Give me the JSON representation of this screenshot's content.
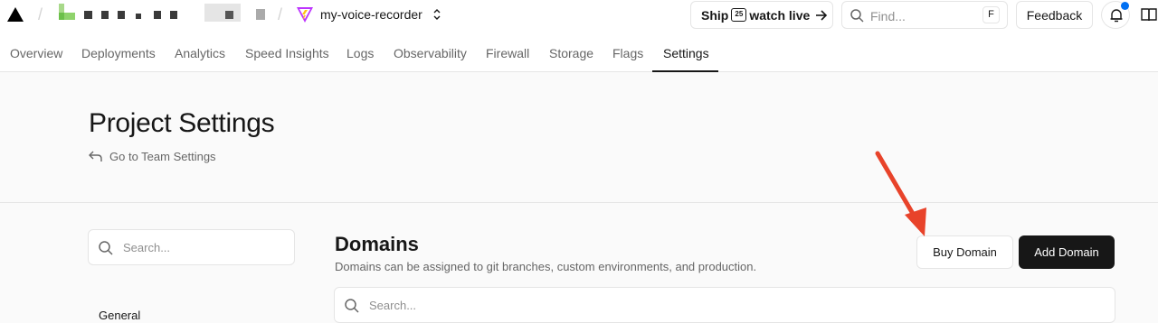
{
  "topbar": {
    "project_name": "my-voice-recorder",
    "ship_label_pre": "Ship",
    "ship_calendar_day": "25",
    "ship_label_post": "watch live",
    "find_placeholder": "Find...",
    "find_shortcut": "F",
    "feedback_label": "Feedback"
  },
  "tabs": [
    {
      "label": "Overview"
    },
    {
      "label": "Deployments"
    },
    {
      "label": "Analytics"
    },
    {
      "label": "Speed Insights"
    },
    {
      "label": "Logs"
    },
    {
      "label": "Observability"
    },
    {
      "label": "Firewall"
    },
    {
      "label": "Storage"
    },
    {
      "label": "Flags"
    },
    {
      "label": "Settings",
      "active": true
    }
  ],
  "header": {
    "title": "Project Settings",
    "back_link": "Go to Team Settings"
  },
  "sidebar": {
    "search_placeholder": "Search...",
    "first_item": "General"
  },
  "domains": {
    "title": "Domains",
    "description": "Domains can be assigned to git branches, custom environments, and production.",
    "buy_label": "Buy Domain",
    "add_label": "Add Domain",
    "search_placeholder": "Search..."
  },
  "colors": {
    "accent_dot": "#0070f3",
    "annotation_arrow": "#e8432a",
    "primary_button": "#171717"
  },
  "icons": [
    "vercel-logo-icon",
    "vite-project-icon",
    "chevron-updown-icon",
    "arrow-right-icon",
    "search-icon",
    "bell-icon",
    "book-icon",
    "return-arrow-icon"
  ]
}
